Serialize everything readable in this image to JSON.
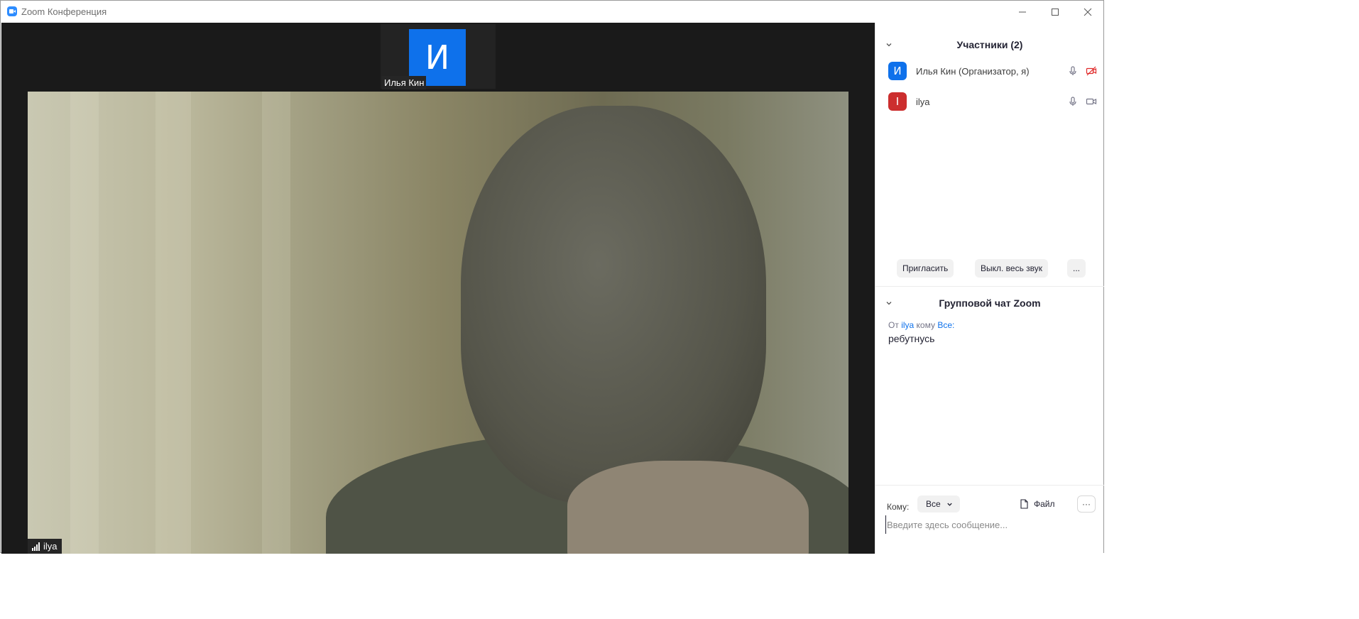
{
  "window": {
    "title": "Zoom Конференция"
  },
  "video": {
    "thumbnail": {
      "initial": "И",
      "name": "Илья Кин",
      "avatar_color": "#0e71eb"
    },
    "main_label": "ilya"
  },
  "participants": {
    "header": "Участники (2)",
    "list": [
      {
        "initial": "И",
        "name": "Илья Кин (Организатор, я)",
        "color": "#0e71eb",
        "mic": "microphone-icon",
        "camera": "camera-off-icon"
      },
      {
        "initial": "I",
        "name": "ilya",
        "color": "#cc2e2e",
        "mic": "microphone-icon",
        "camera": "camera-icon"
      }
    ],
    "actions": {
      "invite": "Пригласить",
      "mute_all": "Выкл. весь звук",
      "more": "..."
    }
  },
  "chat": {
    "header": "Групповой чат Zoom",
    "message_meta": {
      "from_prefix": "От",
      "from": "ilya",
      "to_prefix": "кому",
      "to": "Все:"
    },
    "message_text": "ребутнусь",
    "to_label": "Кому:",
    "recipient": "Все",
    "file_label": "Файл",
    "more": "···",
    "input_placeholder": "Введите здесь сообщение..."
  }
}
